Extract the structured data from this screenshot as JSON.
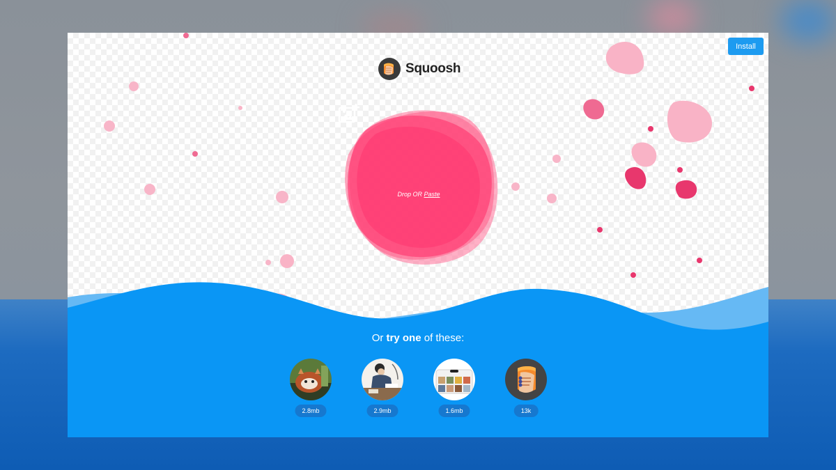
{
  "app": {
    "name": "Squoosh",
    "install_label": "Install"
  },
  "drop": {
    "prefix": "Drop OR ",
    "paste_link": "Paste"
  },
  "samples": {
    "intro_prefix": "Or ",
    "intro_bold": "try one",
    "intro_suffix": " of these:",
    "items": [
      {
        "subject": "red panda",
        "size": "2.8mb"
      },
      {
        "subject": "person drawing",
        "size": "2.9mb"
      },
      {
        "subject": "phone screenshot",
        "size": "1.6mb"
      },
      {
        "subject": "hand holding logo",
        "size": "13k"
      }
    ]
  },
  "colors": {
    "accent_pink": "#ff3d74",
    "wave_blue": "#0a96f5",
    "wave_light_blue": "#66b9f4",
    "install_blue": "#1d9bf0"
  },
  "icons": [
    "squoosh-logo-icon",
    "add-image-icon"
  ]
}
